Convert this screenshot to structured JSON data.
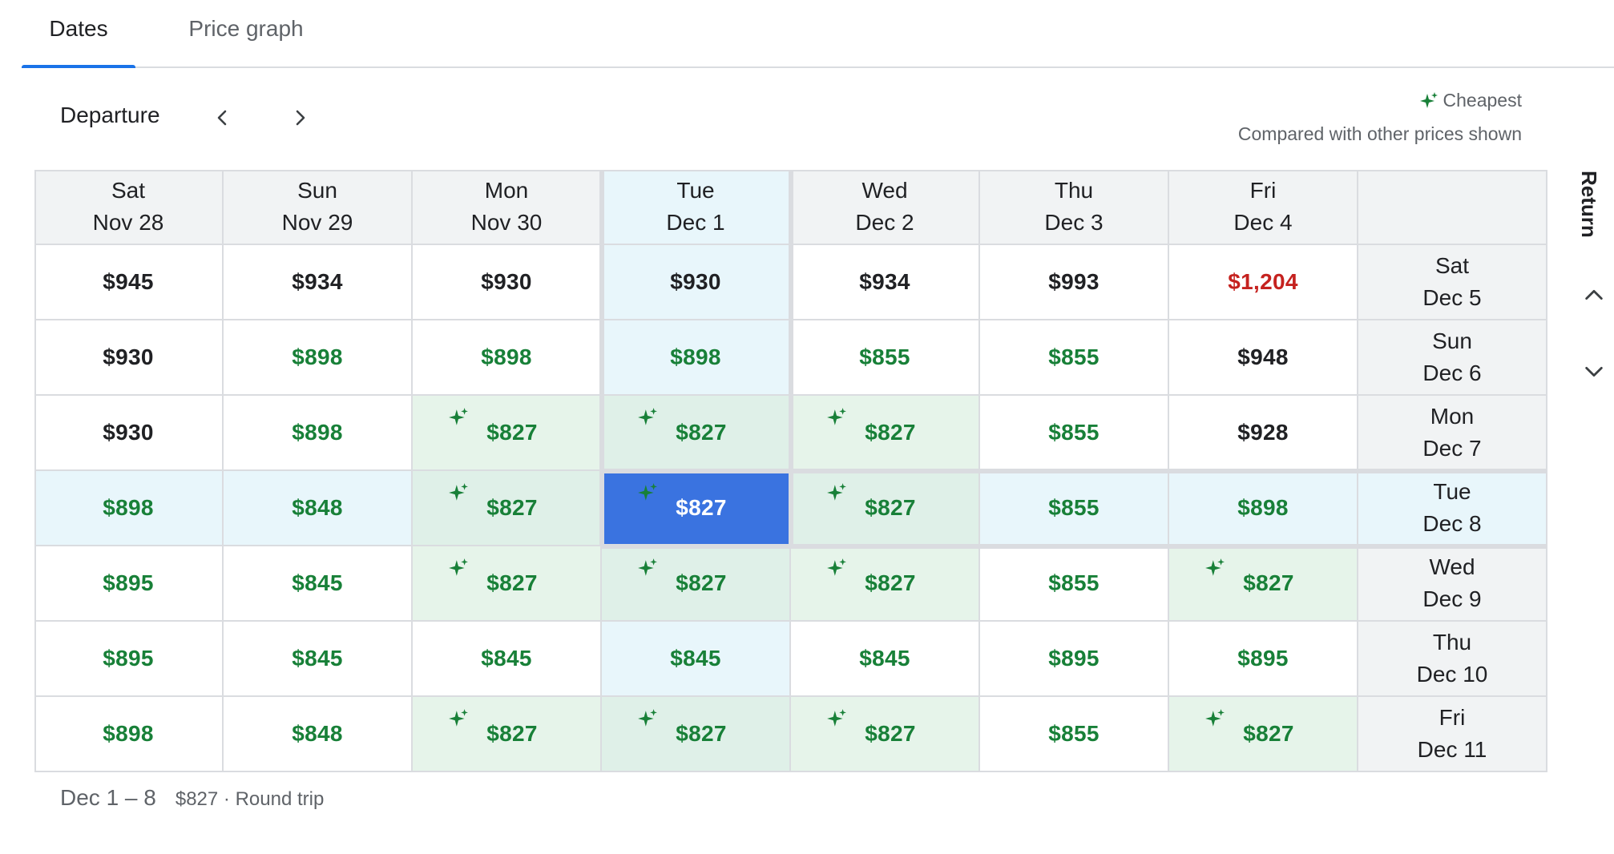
{
  "tabs": [
    {
      "label": "Dates",
      "active": true
    },
    {
      "label": "Price graph",
      "active": false
    }
  ],
  "departure": {
    "label": "Departure",
    "prev_icon": "chevron-left-icon",
    "next_icon": "chevron-right-icon"
  },
  "legend": {
    "cheapest_label": "Cheapest",
    "cheapest_icon": "sparkle-icon",
    "note": "Compared with other prices shown"
  },
  "columns": [
    {
      "day": "Sat",
      "date": "Nov 28"
    },
    {
      "day": "Sun",
      "date": "Nov 29"
    },
    {
      "day": "Mon",
      "date": "Nov 30"
    },
    {
      "day": "Tue",
      "date": "Dec 1"
    },
    {
      "day": "Wed",
      "date": "Dec 2"
    },
    {
      "day": "Thu",
      "date": "Dec 3"
    },
    {
      "day": "Fri",
      "date": "Dec 4"
    }
  ],
  "rows": [
    {
      "day": "Sat",
      "date": "Dec 5",
      "prices": [
        "$945",
        "$934",
        "$930",
        "$930",
        "$934",
        "$993",
        "$1,204"
      ],
      "levels": [
        "normal",
        "normal",
        "normal",
        "normal",
        "normal",
        "normal",
        "high"
      ]
    },
    {
      "day": "Sun",
      "date": "Dec 6",
      "prices": [
        "$930",
        "$898",
        "$898",
        "$898",
        "$855",
        "$855",
        "$948"
      ],
      "levels": [
        "normal",
        "low",
        "low",
        "low",
        "low",
        "low",
        "normal"
      ]
    },
    {
      "day": "Mon",
      "date": "Dec 7",
      "prices": [
        "$930",
        "$898",
        "$827",
        "$827",
        "$827",
        "$855",
        "$928"
      ],
      "levels": [
        "normal",
        "low",
        "cheapest",
        "cheapest",
        "cheapest",
        "low",
        "normal"
      ]
    },
    {
      "day": "Tue",
      "date": "Dec 8",
      "prices": [
        "$898",
        "$848",
        "$827",
        "$827",
        "$827",
        "$855",
        "$898"
      ],
      "levels": [
        "low",
        "low",
        "cheapest",
        "cheapest",
        "cheapest",
        "low",
        "low"
      ]
    },
    {
      "day": "Wed",
      "date": "Dec 9",
      "prices": [
        "$895",
        "$845",
        "$827",
        "$827",
        "$827",
        "$855",
        "$827"
      ],
      "levels": [
        "low",
        "low",
        "cheapest",
        "cheapest",
        "cheapest",
        "low",
        "cheapest"
      ]
    },
    {
      "day": "Thu",
      "date": "Dec 10",
      "prices": [
        "$895",
        "$845",
        "$845",
        "$845",
        "$845",
        "$895",
        "$895"
      ],
      "levels": [
        "low",
        "low",
        "low",
        "low",
        "low",
        "low",
        "low"
      ]
    },
    {
      "day": "Fri",
      "date": "Dec 11",
      "prices": [
        "$898",
        "$848",
        "$827",
        "$827",
        "$827",
        "$855",
        "$827"
      ],
      "levels": [
        "low",
        "low",
        "cheapest",
        "cheapest",
        "cheapest",
        "low",
        "cheapest"
      ]
    }
  ],
  "selected": {
    "column_index": 3,
    "row_index": 3
  },
  "return_panel": {
    "label": "Return",
    "up_icon": "chevron-up-icon",
    "down_icon": "chevron-down-icon"
  },
  "footer": {
    "dates": "Dec 1 – 8",
    "price": "$827 · Round trip"
  },
  "colors": {
    "accent": "#1a73e8",
    "selected_cell": "#3a73e0",
    "low_price": "#188038",
    "high_price": "#c5221f",
    "cheapest_bg": "#e6f4ea",
    "selected_band_bg": "#e8f6fb"
  }
}
